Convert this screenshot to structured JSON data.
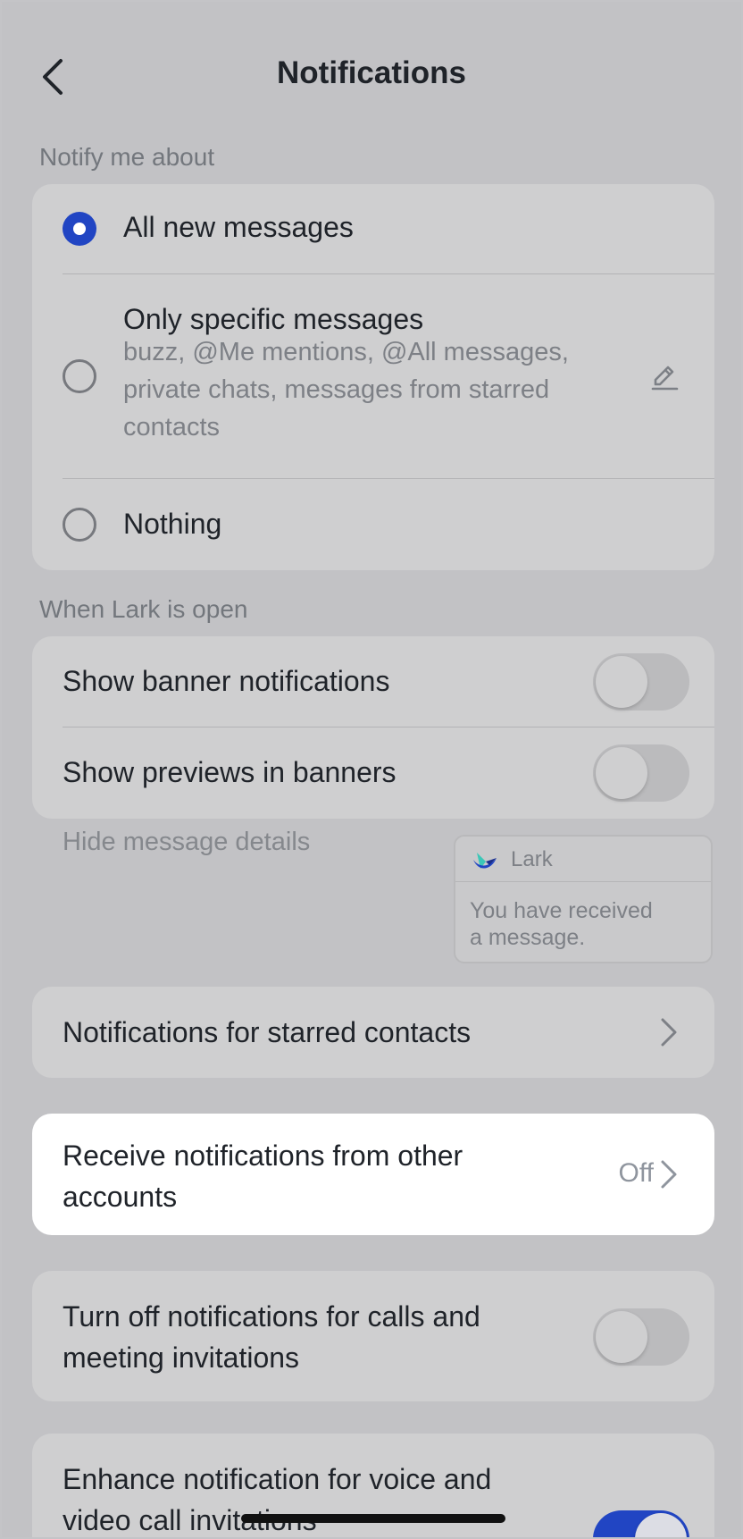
{
  "header": {
    "title": "Notifications"
  },
  "notify_section": {
    "label": "Notify me about",
    "options": [
      {
        "label": "All new messages",
        "selected": true
      },
      {
        "label": "Only specific messages",
        "sublines": [
          "buzz, @Me mentions, @All messages,",
          "private chats, messages from starred",
          "contacts"
        ],
        "selected": false
      },
      {
        "label": "Nothing",
        "selected": false
      }
    ]
  },
  "open_section": {
    "label": "When Lark is open",
    "banner_notifications": {
      "label": "Show banner notifications",
      "on": false
    },
    "previews_in_banners": {
      "label": "Show previews in banners",
      "on": false
    },
    "hint": "Hide message details",
    "preview": {
      "app_name": "Lark",
      "lines": [
        "You have received",
        "a message."
      ]
    }
  },
  "starred_contacts": {
    "label": "Notifications for starred contacts"
  },
  "other_accounts": {
    "lines": [
      "Receive notifications from other",
      "accounts"
    ],
    "value": "Off"
  },
  "calls_meetings": {
    "lines": [
      "Turn off notifications for calls and",
      "meeting invitations"
    ],
    "on": false
  },
  "enhance_voice_video": {
    "lines": [
      "Enhance notification for voice and",
      "video call invitations"
    ],
    "on": true
  },
  "colors": {
    "accent": "#2145c3",
    "background": "#c2c2c5",
    "card": "#cfcfd0",
    "highlight_card": "#ffffff"
  }
}
